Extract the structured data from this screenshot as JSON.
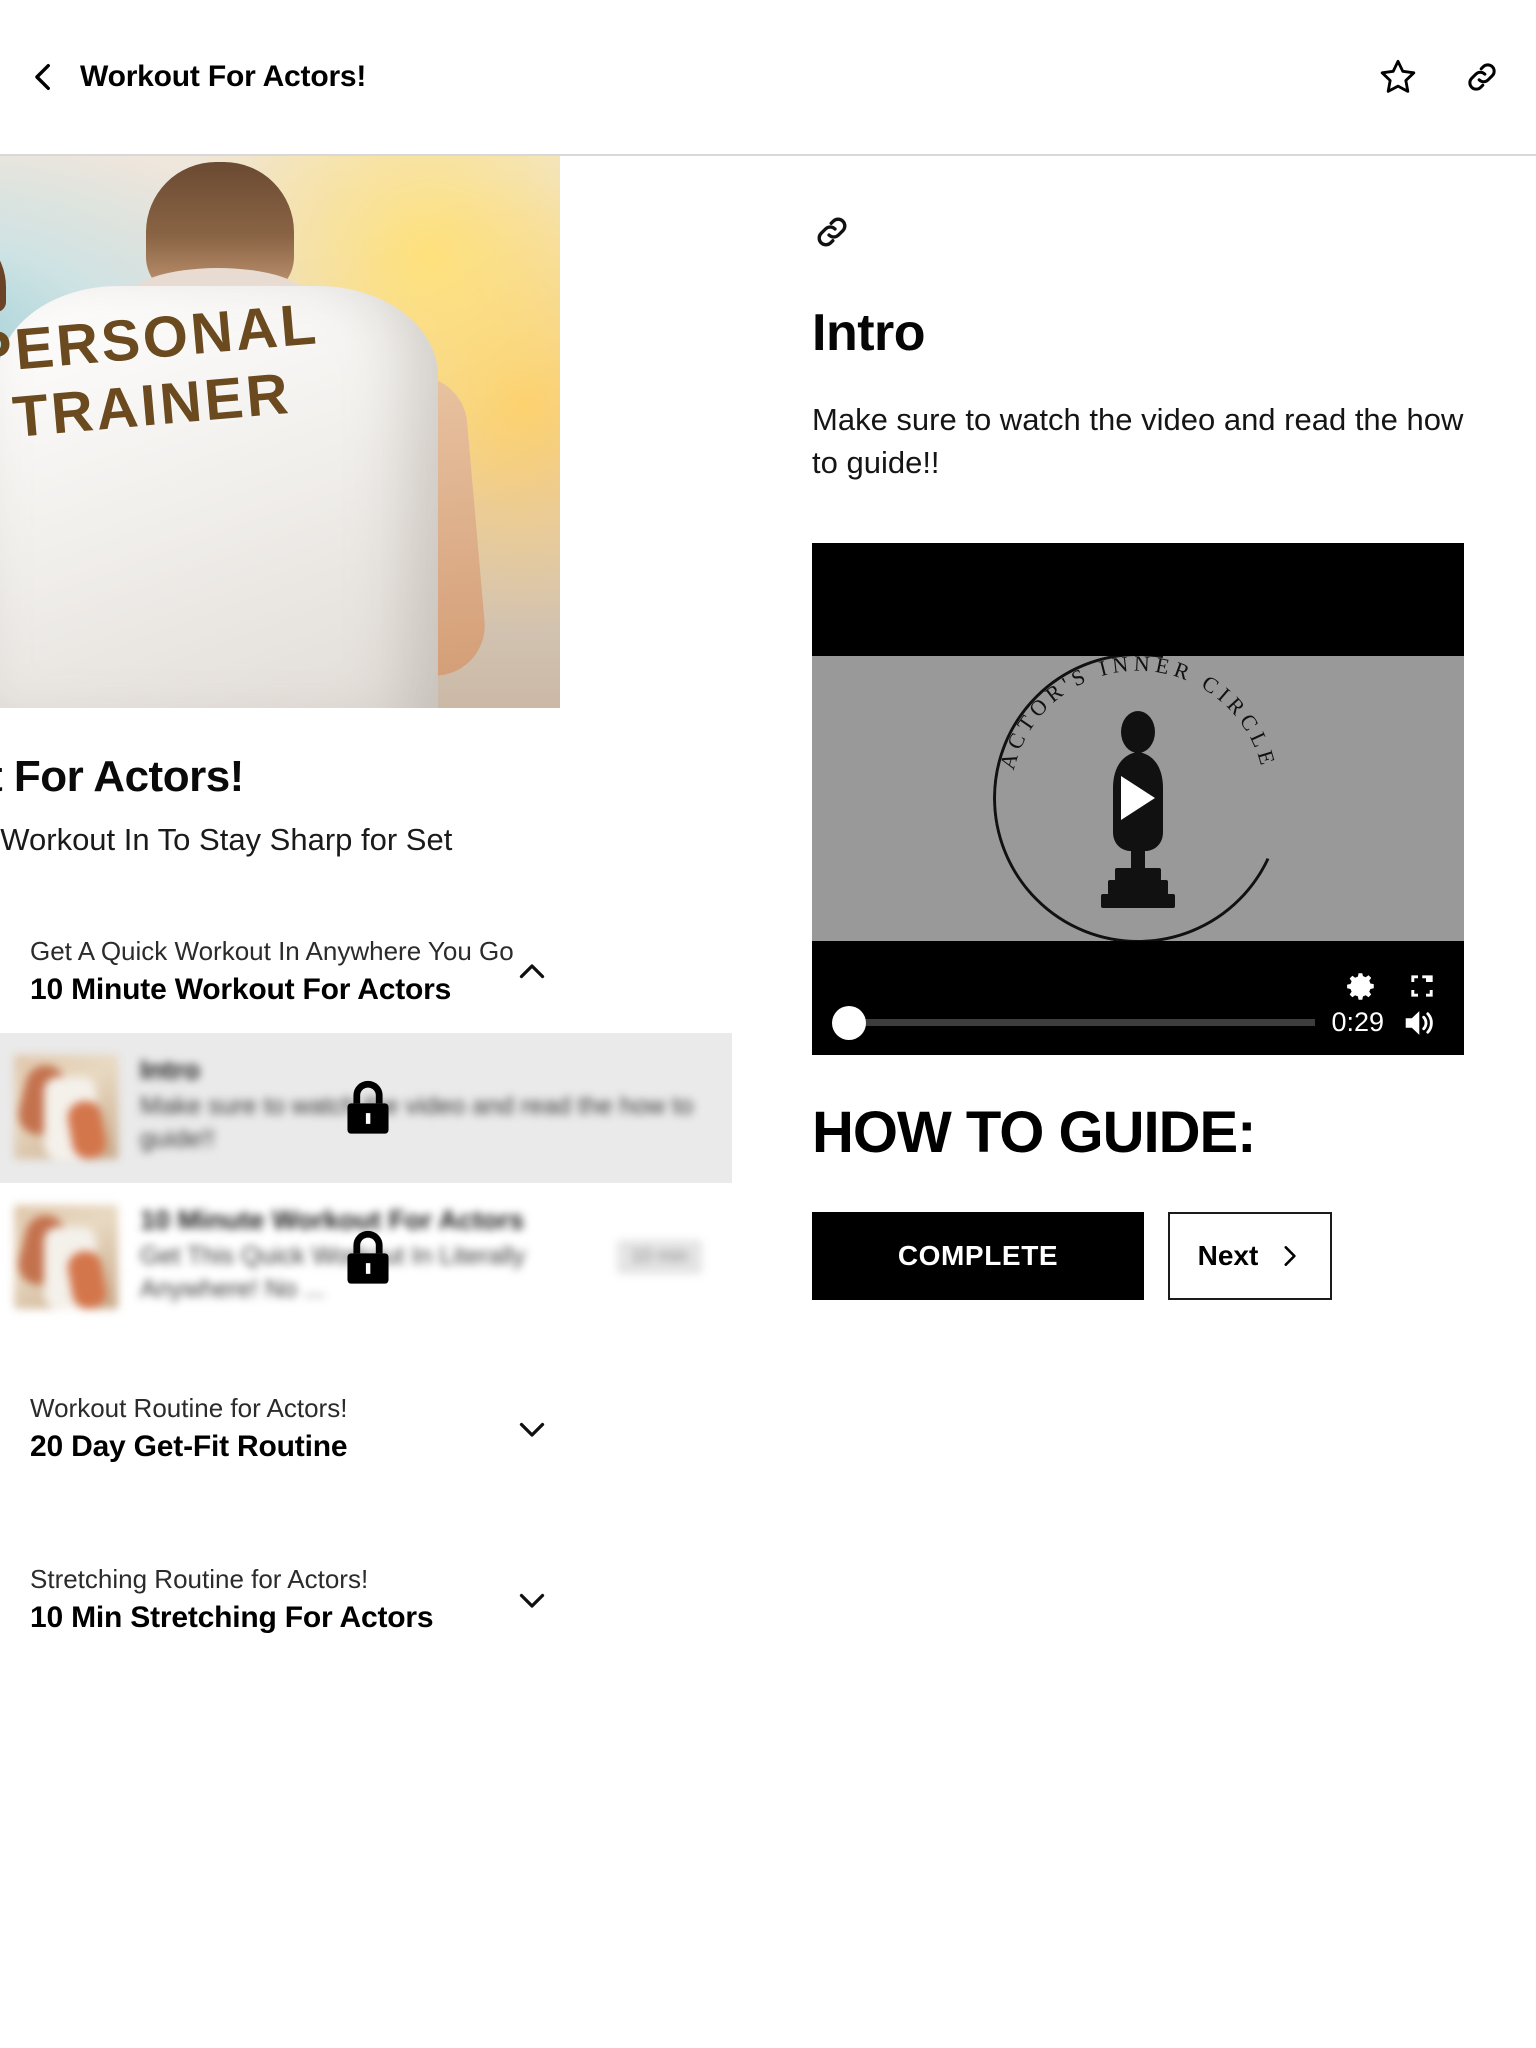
{
  "topbar": {
    "back_icon": "chevron-left-icon",
    "title": "Workout For Actors!",
    "favorite_icon": "star-icon",
    "share_icon": "link-icon"
  },
  "course": {
    "hero_image_text": "PERSONAL TRAINER",
    "title": "Workout For Actors!",
    "subtitle": "Get A Quick Workout In To Stay Sharp for Set"
  },
  "curriculum": [
    {
      "eyebrow": "Get A Quick Workout In Anywhere You Go",
      "title": "10 Minute Workout For Actors",
      "expanded": true,
      "chevron_icon": "chevron-up-icon",
      "lessons": [
        {
          "name": "Intro",
          "desc": "Make sure to watch the video and read the how to guide!!",
          "meta": "",
          "locked": true,
          "active": true,
          "lock_icon": "lock-icon"
        },
        {
          "name": "10 Minute Workout For Actors",
          "desc": "Get This Quick Workout In Literally Anywhere! No ...",
          "meta": "10 min",
          "locked": true,
          "active": false,
          "lock_icon": "lock-icon"
        }
      ]
    },
    {
      "eyebrow": "Workout Routine for Actors!",
      "title": "20 Day Get-Fit Routine",
      "expanded": false,
      "chevron_icon": "chevron-down-icon",
      "lessons": []
    },
    {
      "eyebrow": "Stretching Routine for Actors!",
      "title": "10 Min Stretching For Actors",
      "expanded": false,
      "chevron_icon": "chevron-down-icon",
      "lessons": []
    }
  ],
  "lesson": {
    "link_icon": "link-icon",
    "title": "Intro",
    "body": "Make sure to watch the video and read the how to guide!!",
    "guide_heading": "HOW TO GUIDE:"
  },
  "video": {
    "logo_text": "ACTOR'S INNER CIRCLE",
    "play_icon": "play-icon",
    "settings_icon": "gear-icon",
    "fullscreen_icon": "fullscreen-icon",
    "volume_icon": "volume-icon",
    "time": "0:29",
    "progress_percent": 0,
    "stage_color": "#999999",
    "bar_color": "#000000"
  },
  "actions": {
    "complete_label": "COMPLETE",
    "next_label": "Next",
    "next_icon": "chevron-right-icon"
  }
}
